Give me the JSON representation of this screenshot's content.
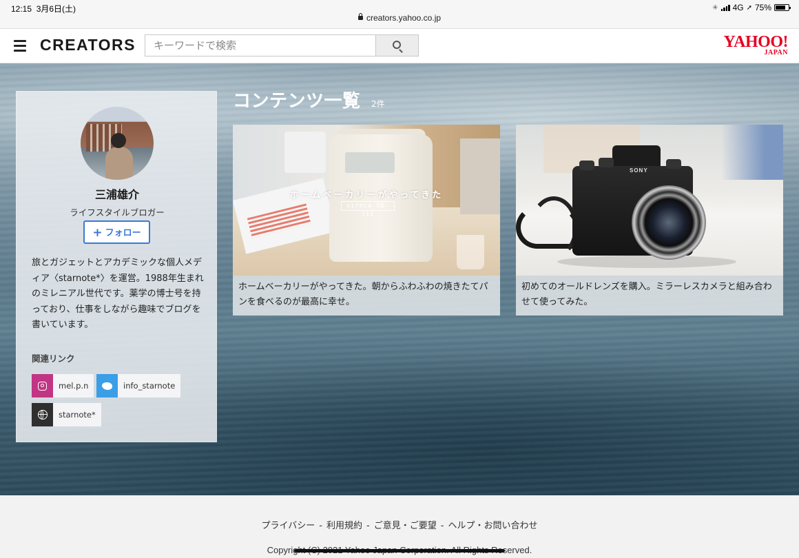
{
  "status_bar": {
    "time": "12:15",
    "date": "3月6日(土)",
    "url": "creators.yahoo.co.jp",
    "network": "4G",
    "battery": "75%",
    "battery_level": 0.75
  },
  "header": {
    "brand": "CREATORS",
    "search_placeholder": "キーワードで検索",
    "yahoo_logo_main": "YAHOO!",
    "yahoo_logo_sub": "JAPAN",
    "icons": [
      "menu-icon",
      "search-icon"
    ]
  },
  "profile": {
    "name": "三浦雄介",
    "role": "ライフスタイルブロガー",
    "follow_label": "フォロー",
    "bio": "旅とガジェットとアカデミックな個人メディア〈starnote*〉を運営。1988年生まれのミレニアル世代です。薬学の博士号を持っており、仕事をしながら趣味でブログを書いています。",
    "links_title": "関連リンク",
    "links": [
      {
        "icon": "instagram-icon",
        "label": "mel.p.n",
        "color": "#c13584"
      },
      {
        "icon": "twitter-icon",
        "label": "info_starnote",
        "color": "#3b9ee6"
      },
      {
        "icon": "globe-icon",
        "label": "starnote*",
        "color": "#2f2f2f"
      }
    ]
  },
  "content": {
    "title": "コンテンツ一覧",
    "count": "2件",
    "cards": [
      {
        "image_title": "ホームベーカリーがやってきた",
        "image_sub": "siroca SB-111",
        "caption": "ホームベーカリーがやってきた。朝からふわふわの焼きたてパンを食べるのが最高に幸せ。"
      },
      {
        "image_brand": "SONY",
        "caption": "初めてのオールドレンズを購入。ミラーレスカメラと組み合わせて使ってみた。"
      }
    ]
  },
  "footer": {
    "links": [
      "プライバシー",
      "利用規約",
      "ご意見・ご要望",
      "ヘルプ・お問い合わせ"
    ],
    "separator": "-",
    "copyright": "Copyright (C) 2021 Yahoo Japan Corporation. All Rights Reserved."
  },
  "colors": {
    "accent": "#3a78d6",
    "yahoo_red": "#e60023"
  }
}
